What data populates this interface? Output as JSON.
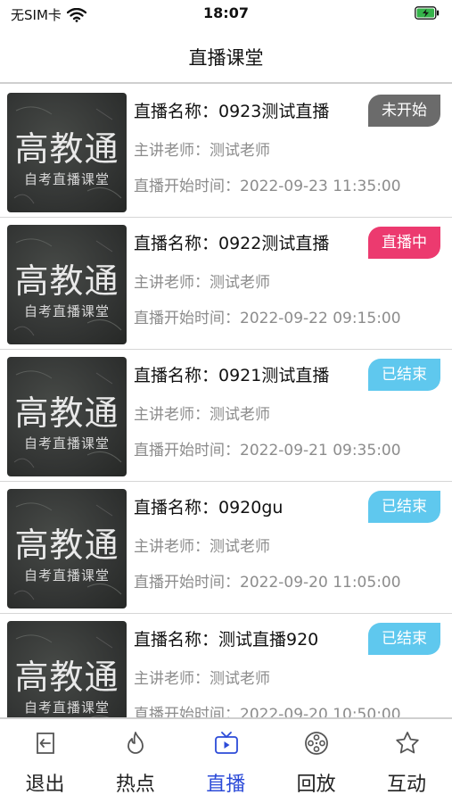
{
  "status_bar": {
    "carrier": "无SIM卡",
    "time": "18:07",
    "battery_color": "#35b34a"
  },
  "header": {
    "title": "直播课堂"
  },
  "thumbnail": {
    "main_text": "高教通",
    "sub_text": "自考直播课堂"
  },
  "lives": [
    {
      "name": "直播名称：0923测试直播",
      "teacher": "主讲老师：测试老师",
      "start_time": "直播开始时间：2022-09-23 11:35:00",
      "status": "未开始",
      "status_color": "#6b6b6b"
    },
    {
      "name": "直播名称：0922测试直播",
      "teacher": "主讲老师：测试老师",
      "start_time": "直播开始时间：2022-09-22 09:15:00",
      "status": "直播中",
      "status_color": "#ec3a6f"
    },
    {
      "name": "直播名称：0921测试直播",
      "teacher": "主讲老师：测试老师",
      "start_time": "直播开始时间：2022-09-21 09:35:00",
      "status": "已结束",
      "status_color": "#5fc8ee"
    },
    {
      "name": "直播名称：0920gu",
      "teacher": "主讲老师：测试老师",
      "start_time": "直播开始时间：2022-09-20 11:05:00",
      "status": "已结束",
      "status_color": "#5fc8ee"
    },
    {
      "name": "直播名称：测试直播920",
      "teacher": "主讲老师：测试老师",
      "start_time": "直播开始时间：2022-09-20 10:50:00",
      "status": "已结束",
      "status_color": "#5fc8ee"
    }
  ],
  "tabs": [
    {
      "label": "退出",
      "icon": "logout-icon"
    },
    {
      "label": "热点",
      "icon": "flame-icon"
    },
    {
      "label": "直播",
      "icon": "live-tv-icon",
      "active": true
    },
    {
      "label": "回放",
      "icon": "film-reel-icon"
    },
    {
      "label": "互动",
      "icon": "star-icon"
    }
  ],
  "colors": {
    "active_tab": "#2c4bd8",
    "inactive_tab": "#222222"
  }
}
